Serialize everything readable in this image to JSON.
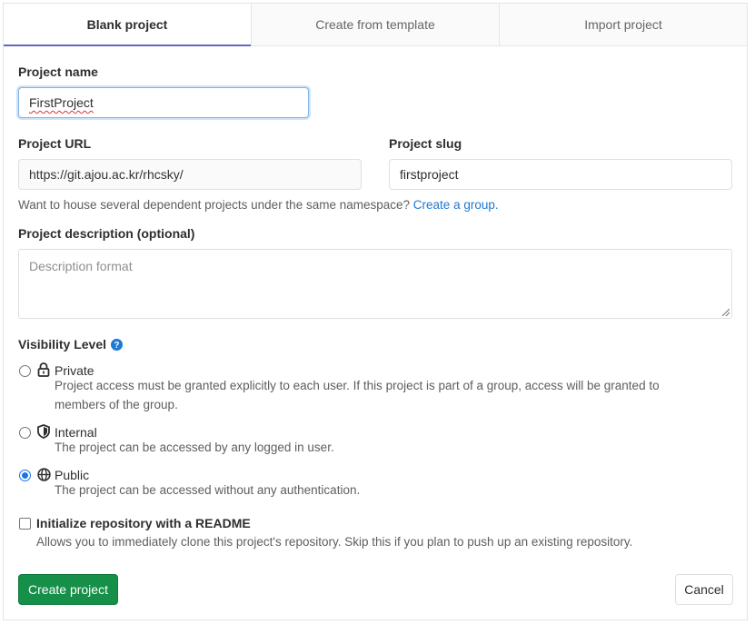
{
  "tabs": [
    {
      "label": "Blank project",
      "active": true
    },
    {
      "label": "Create from template",
      "active": false
    },
    {
      "label": "Import project",
      "active": false
    }
  ],
  "project_name": {
    "label": "Project name",
    "value": "FirstProject"
  },
  "project_url": {
    "label": "Project URL",
    "value": "https://git.ajou.ac.kr/rhcsky/"
  },
  "project_slug": {
    "label": "Project slug",
    "value": "firstproject"
  },
  "namespace_help": {
    "text": "Want to house several dependent projects under the same namespace?",
    "link": "Create a group."
  },
  "description": {
    "label": "Project description (optional)",
    "placeholder": "Description format"
  },
  "visibility": {
    "label": "Visibility Level",
    "help_icon": "question-circle-icon",
    "options": [
      {
        "title": "Private",
        "icon": "lock-icon",
        "checked": false,
        "desc_line1": "Project access must be granted explicitly to each user. If this project is part of a group, access will be granted to",
        "desc_line2": "members of the group."
      },
      {
        "title": "Internal",
        "icon": "shield-icon",
        "checked": false,
        "desc_line1": "The project can be accessed by any logged in user."
      },
      {
        "title": "Public",
        "icon": "globe-icon",
        "checked": true,
        "desc_line1": "The project can be accessed without any authentication."
      }
    ]
  },
  "readme": {
    "label": "Initialize repository with a README",
    "desc": "Allows you to immediately clone this project's repository. Skip this if you plan to push up an existing repository.",
    "checked": false
  },
  "actions": {
    "create": "Create project",
    "cancel": "Cancel"
  },
  "colors": {
    "accent": "#6666c4",
    "primary_button": "#168f48",
    "link": "#1f78d1",
    "radio_checked": "#1a73e8"
  }
}
